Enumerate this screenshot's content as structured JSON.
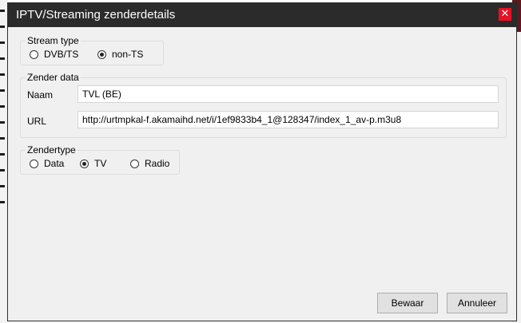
{
  "dialog": {
    "title": "IPTV/Streaming zenderdetails",
    "close_glyph": "✕"
  },
  "stream_type": {
    "legend": "Stream type",
    "options": [
      {
        "label": "DVB/TS",
        "selected": false
      },
      {
        "label": "non-TS",
        "selected": true
      }
    ]
  },
  "zender_data": {
    "legend": "Zender data",
    "naam_label": "Naam",
    "naam_value": "TVL (BE)",
    "url_label": "URL",
    "url_value": "http://urtmpkal-f.akamaihd.net/i/1ef9833b4_1@128347/index_1_av-p.m3u8"
  },
  "zendertype": {
    "legend": "Zendertype",
    "options": [
      {
        "label": "Data",
        "selected": false
      },
      {
        "label": "TV",
        "selected": true
      },
      {
        "label": "Radio",
        "selected": false
      }
    ]
  },
  "buttons": {
    "save_label": "Bewaar",
    "cancel_label": "Annuleer"
  }
}
